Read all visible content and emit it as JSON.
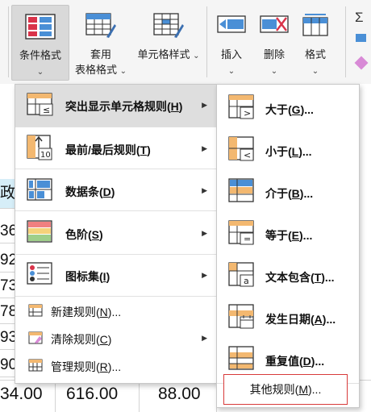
{
  "ribbon": {
    "conditional_format": "条件格式",
    "format_table_line1": "套用",
    "format_table_line2": "表格格式",
    "cell_styles": "单元格样式",
    "insert": "插入",
    "delete": "删除",
    "format": "格式",
    "dropdown_chevron": "⌄"
  },
  "sheet": {
    "header_fragment": "政",
    "col_a_fragments": [
      "36",
      "92",
      "73",
      "78",
      "93",
      "90"
    ],
    "bottom_row": [
      "34.00",
      "616.00",
      "88.00"
    ]
  },
  "main_menu": {
    "items": [
      {
        "label": "突出显示单元格规则",
        "key": "H"
      },
      {
        "label": "最前/最后规则",
        "key": "T"
      },
      {
        "label": "数据条",
        "key": "D"
      },
      {
        "label": "色阶",
        "key": "S"
      },
      {
        "label": "图标集",
        "key": "I"
      }
    ],
    "commands": [
      {
        "label": "新建规则",
        "key": "N",
        "suffix": "..."
      },
      {
        "label": "清除规则",
        "key": "C",
        "suffix": ""
      },
      {
        "label": "管理规则",
        "key": "R",
        "suffix": "..."
      }
    ],
    "submenu_arrow": "▶"
  },
  "sub_menu": {
    "items": [
      {
        "label": "大于",
        "key": "G"
      },
      {
        "label": "小于",
        "key": "L"
      },
      {
        "label": "介于",
        "key": "B"
      },
      {
        "label": "等于",
        "key": "E"
      },
      {
        "label": "文本包含",
        "key": "T"
      },
      {
        "label": "发生日期",
        "key": "A"
      },
      {
        "label": "重复值",
        "key": "D"
      }
    ],
    "other_rules": {
      "label": "其他规则",
      "key": "M"
    }
  },
  "colors": {
    "accent_red": "#d83a3a",
    "highlight_blue": "#4a8fd6",
    "header_cyan": "#d6eef8"
  },
  "icons": [
    "conditional-format-icon",
    "format-as-table-icon",
    "cell-styles-icon",
    "insert-icon",
    "delete-icon",
    "format-icon",
    "highlight-rules-icon",
    "top-bottom-icon",
    "data-bars-icon",
    "color-scales-icon",
    "icon-sets-icon",
    "new-rule-icon",
    "clear-rules-icon",
    "manage-rules-icon",
    "greater-than-icon",
    "less-than-icon",
    "between-icon",
    "equal-to-icon",
    "text-contains-icon",
    "date-occurring-icon",
    "duplicate-values-icon"
  ]
}
